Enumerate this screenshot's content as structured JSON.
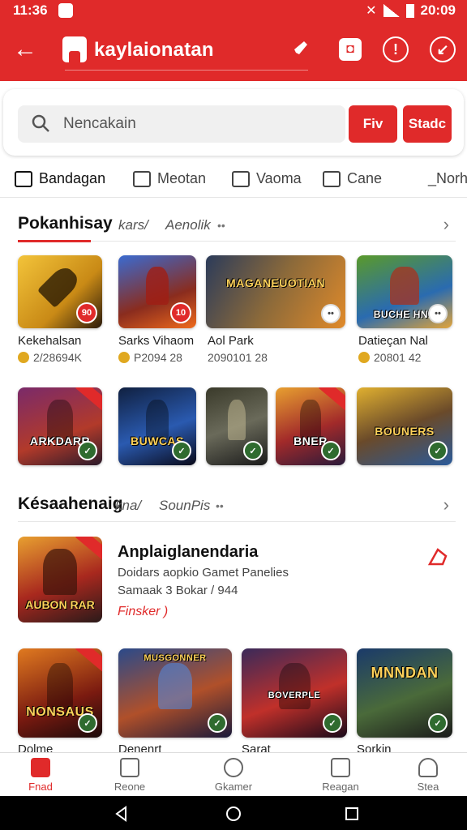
{
  "status": {
    "time": "11:36",
    "right_time": "20:09"
  },
  "app": {
    "title": "kaylaionatan"
  },
  "search": {
    "placeholder": "Nencakain",
    "btn1": "Fiv",
    "btn2": "Stadc"
  },
  "tabs": [
    {
      "label": "Bandagan",
      "icon": "book-icon"
    },
    {
      "label": "Meotan",
      "icon": "map-icon"
    },
    {
      "label": "Vaoma",
      "icon": "bookmark-icon"
    },
    {
      "label": "Cane",
      "icon": "share-icon"
    },
    {
      "label": "_Norh",
      "icon": "tag-icon"
    }
  ],
  "section1": {
    "title": "Pokanhisay",
    "sub": "kars/",
    "tag": "Aenolik",
    "row1": [
      {
        "art_text": "",
        "name": "Kekehalsan",
        "meta": "2/28694K",
        "badge": "90"
      },
      {
        "art_text": "",
        "name": "Sarks Vihaom",
        "meta": "P2094 28",
        "badge": "10"
      },
      {
        "art_text": "MAGANEUOTIAN",
        "name": "Aol Park",
        "meta": "2090101 28",
        "badge": "••"
      },
      {
        "art_text": "BUCHE HNR",
        "name": "Datieçan Nal",
        "meta": "20801 42",
        "badge": "••"
      }
    ],
    "row2": [
      {
        "art_text": "ARKDARR"
      },
      {
        "art_text": "BUWCAS"
      },
      {
        "art_text": ""
      },
      {
        "art_text": "BNER"
      },
      {
        "art_text": "BOUNERS"
      }
    ]
  },
  "section2": {
    "title": "Késaahenaig",
    "sub": "kna/",
    "tag": "SounPis",
    "featured": {
      "art_text": "AUBON RAR",
      "title": "Anplaiglanendaria",
      "line1": "Doidars aopkio Gamet Panelies",
      "line2": "Samaak 3 Bokar / 944",
      "link": "Finsker )"
    },
    "row": [
      {
        "art_text": "NONSAUS",
        "name": "Dolme"
      },
      {
        "art_text": "MUSGONNER",
        "name": "Denenrt"
      },
      {
        "art_text": "BOVERPLE",
        "name": "Sarat"
      },
      {
        "art_text": "MNNDAN",
        "name": "Sorkin"
      }
    ]
  },
  "bottom_nav": [
    {
      "label": "Fnad",
      "icon": "home-icon",
      "active": true
    },
    {
      "label": "Reone",
      "icon": "list-icon"
    },
    {
      "label": "Gkamer",
      "icon": "chat-icon"
    },
    {
      "label": "Reagan",
      "icon": "calendar-icon"
    },
    {
      "label": "Stea",
      "icon": "profile-icon"
    }
  ],
  "colors": {
    "brand": "#e02a2a"
  }
}
